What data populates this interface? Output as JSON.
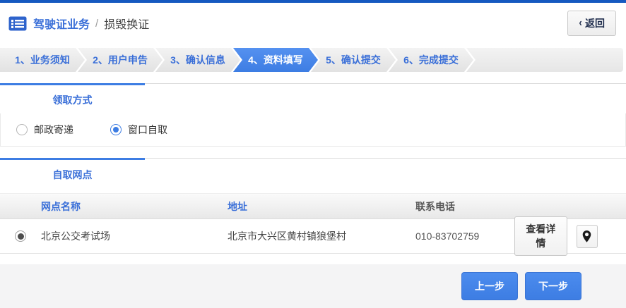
{
  "header": {
    "title_primary": "驾驶证业务",
    "separator": "/",
    "title_secondary": "损毁换证",
    "back_chevron": "‹",
    "back_label": "返回"
  },
  "steps": {
    "items": [
      {
        "label": "1、业务须知",
        "active": false
      },
      {
        "label": "2、用户申告",
        "active": false
      },
      {
        "label": "3、确认信息",
        "active": false
      },
      {
        "label": "4、资料填写",
        "active": true
      },
      {
        "label": "5、确认提交",
        "active": false
      },
      {
        "label": "6、完成提交",
        "active": false
      }
    ]
  },
  "pickup_section": {
    "title": "领取方式",
    "options": [
      {
        "label": "邮政寄递",
        "selected": false
      },
      {
        "label": "窗口自取",
        "selected": true
      }
    ]
  },
  "outlets_section": {
    "title": "自取网点",
    "table": {
      "columns": [
        "网点名称",
        "地址",
        "联系电话"
      ],
      "rows": [
        {
          "selected": true,
          "name": "北京公交考试场",
          "address": "北京市大兴区黄村镇狼堡村",
          "phone": "010-83702759",
          "detail_label": "查看详情",
          "pin_icon": "map-pin-icon"
        }
      ]
    }
  },
  "footer": {
    "prev_label": "上一步",
    "next_label": "下一步"
  },
  "colors": {
    "primary_blue": "#3d7de3",
    "link_blue": "#3a6fd8",
    "top_border_blue": "#1659c0"
  }
}
